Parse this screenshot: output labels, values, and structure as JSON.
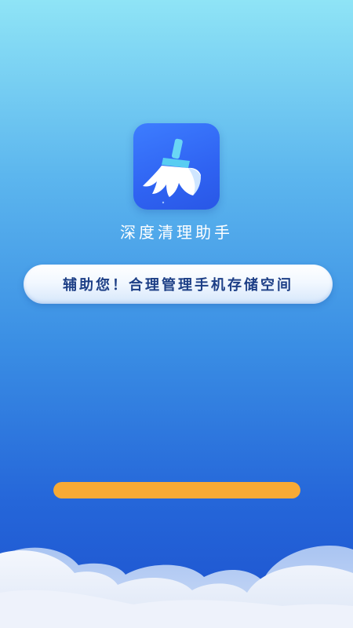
{
  "app": {
    "name": "深度清理助手",
    "icon": "broom-icon"
  },
  "slogan": {
    "text": "辅助您！合理管理手机存储空间"
  },
  "progress": {
    "value": 1.0
  },
  "colors": {
    "background_top": "#8fe4f6",
    "background_bottom": "#1d52cf",
    "icon_bg": "#2f63f2",
    "slogan_text": "#1d3f86",
    "progress_fill": "#f7aa35"
  },
  "decor": {
    "clouds": "clouds-icon"
  }
}
